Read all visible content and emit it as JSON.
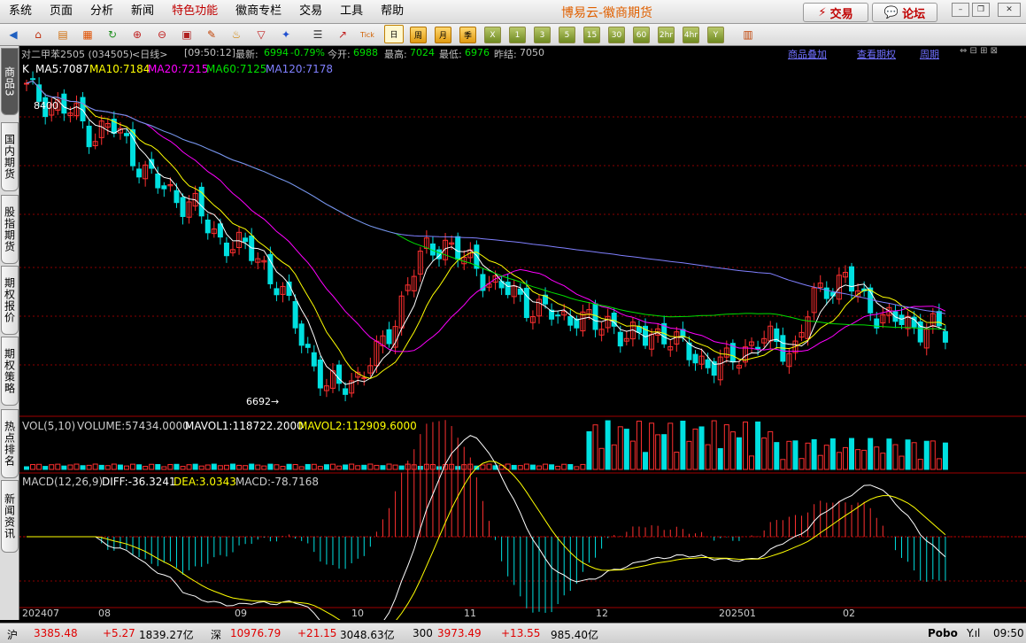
{
  "menu": [
    "系统",
    "页面",
    "分析",
    "新闻",
    "特色功能",
    "徽商专栏",
    "交易",
    "工具",
    "帮助"
  ],
  "brand": "博易云-徽商期货",
  "top_buttons": {
    "trade": "交易",
    "forum": "论坛"
  },
  "window_controls": {
    "minimize": "–",
    "restore": "❐",
    "close": "✕"
  },
  "toolbar_periods": [
    "日",
    "周",
    "月",
    "季",
    "X",
    "1",
    "3",
    "5",
    "15",
    "30",
    "60",
    "2hr",
    "4hr",
    "Y"
  ],
  "sidebar_tabs": [
    "商品3",
    "国内期货",
    "股指期货",
    "期权报价",
    "期权策略",
    "热点排名",
    "新闻资讯"
  ],
  "info": {
    "contract": "对二甲苯2505 (034505)",
    "period": "<日线>",
    "time": "[09:50:12]",
    "latest_label": "最新:",
    "latest_value": "6994",
    "change": "-0.79%",
    "open_label": "今开:",
    "open_value": "6988",
    "high_label": "最高:",
    "high_value": "7024",
    "low_label": "最低:",
    "low_value": "6976",
    "prev_label": "昨结:",
    "prev_value": "7050",
    "link_overlay": "商品叠加",
    "link_options": "查看期权",
    "link_period": "周期"
  },
  "ma": {
    "k": "K",
    "ma5": "MA5:7087",
    "ma10": "MA10:7184",
    "ma20": "MA20:7215",
    "ma60": "MA60:7125",
    "ma120": "MA120:7178"
  },
  "colors": {
    "ma5": "#ffffff",
    "ma10": "#ffff00",
    "ma20": "#ff00ff",
    "ma60": "#00e000",
    "ma120": "#8080ff",
    "up": "#ff3030",
    "down": "#00e0e0",
    "grid": "#8b0000"
  },
  "annotations": {
    "high_mark": "8400",
    "low_mark": "6692→"
  },
  "volume": {
    "label": "VOL(5,10)",
    "volume": "VOLUME:57434.0000",
    "mavol1": "MAVOL1:118722.2000",
    "mavol2": "MAVOL2:112909.6000"
  },
  "macd": {
    "label": "MACD(12,26,9)",
    "diff": "DIFF:-36.3241",
    "dea": "DEA:3.0343",
    "macd": "MACD:-78.7168"
  },
  "x_axis": [
    "202407",
    "08",
    "09",
    "10",
    "11",
    "12",
    "202501",
    "02"
  ],
  "status": {
    "sh_label": "沪",
    "sh_value": "3385.48",
    "sh_change": "+5.27",
    "sh_amount": "1839.27亿",
    "sz_label": "深",
    "sz_value": "10976.79",
    "sz_change": "+21.15",
    "sz_amount": "3048.63亿",
    "i300_label": "300",
    "i300_value": "3973.49",
    "i300_change": "+13.55",
    "i300_amount": "985.40亿",
    "brand": "Pobo",
    "clock": "09:50"
  },
  "chart_data": {
    "type": "candlestick",
    "price_marks": {
      "high": 8400,
      "low": 6692
    },
    "closes_approx": [
      8400,
      8350,
      8300,
      8250,
      8150,
      8200,
      8100,
      7950,
      7850,
      7800,
      7750,
      7600,
      7550,
      7500,
      7450,
      7300,
      7100,
      6900,
      6700,
      6750,
      6800,
      6900,
      7100,
      7350,
      7500,
      7550,
      7450,
      7400,
      7300,
      7250,
      7200,
      7150,
      7100,
      7150,
      7050,
      7100,
      7000,
      7000,
      7050,
      6950,
      6900,
      6850,
      6850,
      6950,
      7000,
      6950,
      6950,
      7200,
      7300,
      7350,
      7200,
      7150,
      7100,
      7050,
      7100,
      7000
    ],
    "macd_series": [
      "DIFF",
      "DEA",
      "MACD"
    ]
  }
}
